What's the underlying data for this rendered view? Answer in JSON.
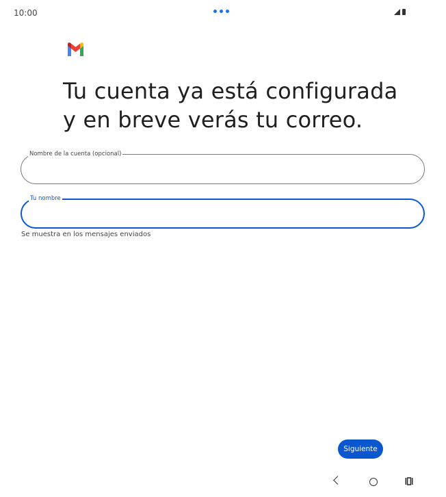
{
  "status_bar": {
    "time": "10:00"
  },
  "header": {
    "logo_icon": "gmail-logo-icon",
    "title_line1": "Tu cuenta ya está configurada",
    "title_line2": "y en breve verás tu correo."
  },
  "form": {
    "account_name": {
      "label": "Nombre de la cuenta (opcional)",
      "value": ""
    },
    "your_name": {
      "label": "Tu nombre",
      "value": "",
      "helper": "Se muestra en los mensajes enviados"
    }
  },
  "actions": {
    "next_label": "Siguiente"
  },
  "nav": {
    "back_icon": "back-icon",
    "home_icon": "home-icon",
    "recents_icon": "recents-icon"
  },
  "colors": {
    "accent": "#0b57d0",
    "camera_dots": "#1a73e8"
  }
}
